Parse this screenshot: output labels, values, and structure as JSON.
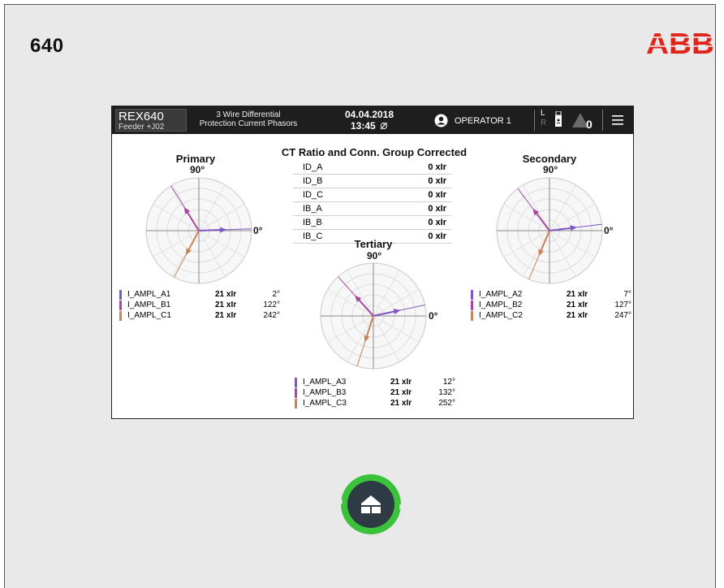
{
  "page": {
    "model": "640"
  },
  "brand": {
    "logo": "ABB",
    "color": "#e2231a"
  },
  "device": {
    "name": "REX640",
    "feeder": "Feeder +J02"
  },
  "header": {
    "title_line1": "3 Wire Differential",
    "title_line2": "Protection Current Phasors",
    "date": "04.04.2018",
    "time": "13:45",
    "time_icon": "clock-sync-icon",
    "operator": "OPERATOR 1",
    "local": "L",
    "remote": "R",
    "alarm_count": "0"
  },
  "ratio": {
    "title": "CT Ratio and Conn. Group Corrected",
    "rows": [
      {
        "name": "ID_A",
        "value": "0 xIr"
      },
      {
        "name": "ID_B",
        "value": "0 xIr"
      },
      {
        "name": "ID_C",
        "value": "0 xIr"
      },
      {
        "name": "IB_A",
        "value": "0 xIr"
      },
      {
        "name": "IB_B",
        "value": "0 xIr"
      },
      {
        "name": "IB_C",
        "value": "0 xIr"
      }
    ]
  },
  "phasors": {
    "deg90": "90°",
    "deg0": "0°",
    "colors": {
      "a": "#7e55c2",
      "b": "#a946a0",
      "c": "#c9835a"
    },
    "primary": {
      "label": "Primary",
      "legend": [
        {
          "name": "I_AMPL_A1",
          "mag": "21 xIr",
          "ang": "2°"
        },
        {
          "name": "I_AMPL_B1",
          "mag": "21 xIr",
          "ang": "122°"
        },
        {
          "name": "I_AMPL_C1",
          "mag": "21 xIr",
          "ang": "242°"
        }
      ]
    },
    "secondary": {
      "label": "Secondary",
      "legend": [
        {
          "name": "I_AMPL_A2",
          "mag": "21 xIr",
          "ang": "7°"
        },
        {
          "name": "I_AMPL_B2",
          "mag": "21 xIr",
          "ang": "127°"
        },
        {
          "name": "I_AMPL_C2",
          "mag": "21 xIr",
          "ang": "247°"
        }
      ]
    },
    "tertiary": {
      "label": "Tertiary",
      "legend": [
        {
          "name": "I_AMPL_A3",
          "mag": "21 xIr",
          "ang": "12°"
        },
        {
          "name": "I_AMPL_B3",
          "mag": "21 xIr",
          "ang": "132°"
        },
        {
          "name": "I_AMPL_C3",
          "mag": "21 xIr",
          "ang": "252°"
        }
      ]
    }
  },
  "home": {
    "icon": "home-icon",
    "ring_color": "#3ac23a"
  }
}
